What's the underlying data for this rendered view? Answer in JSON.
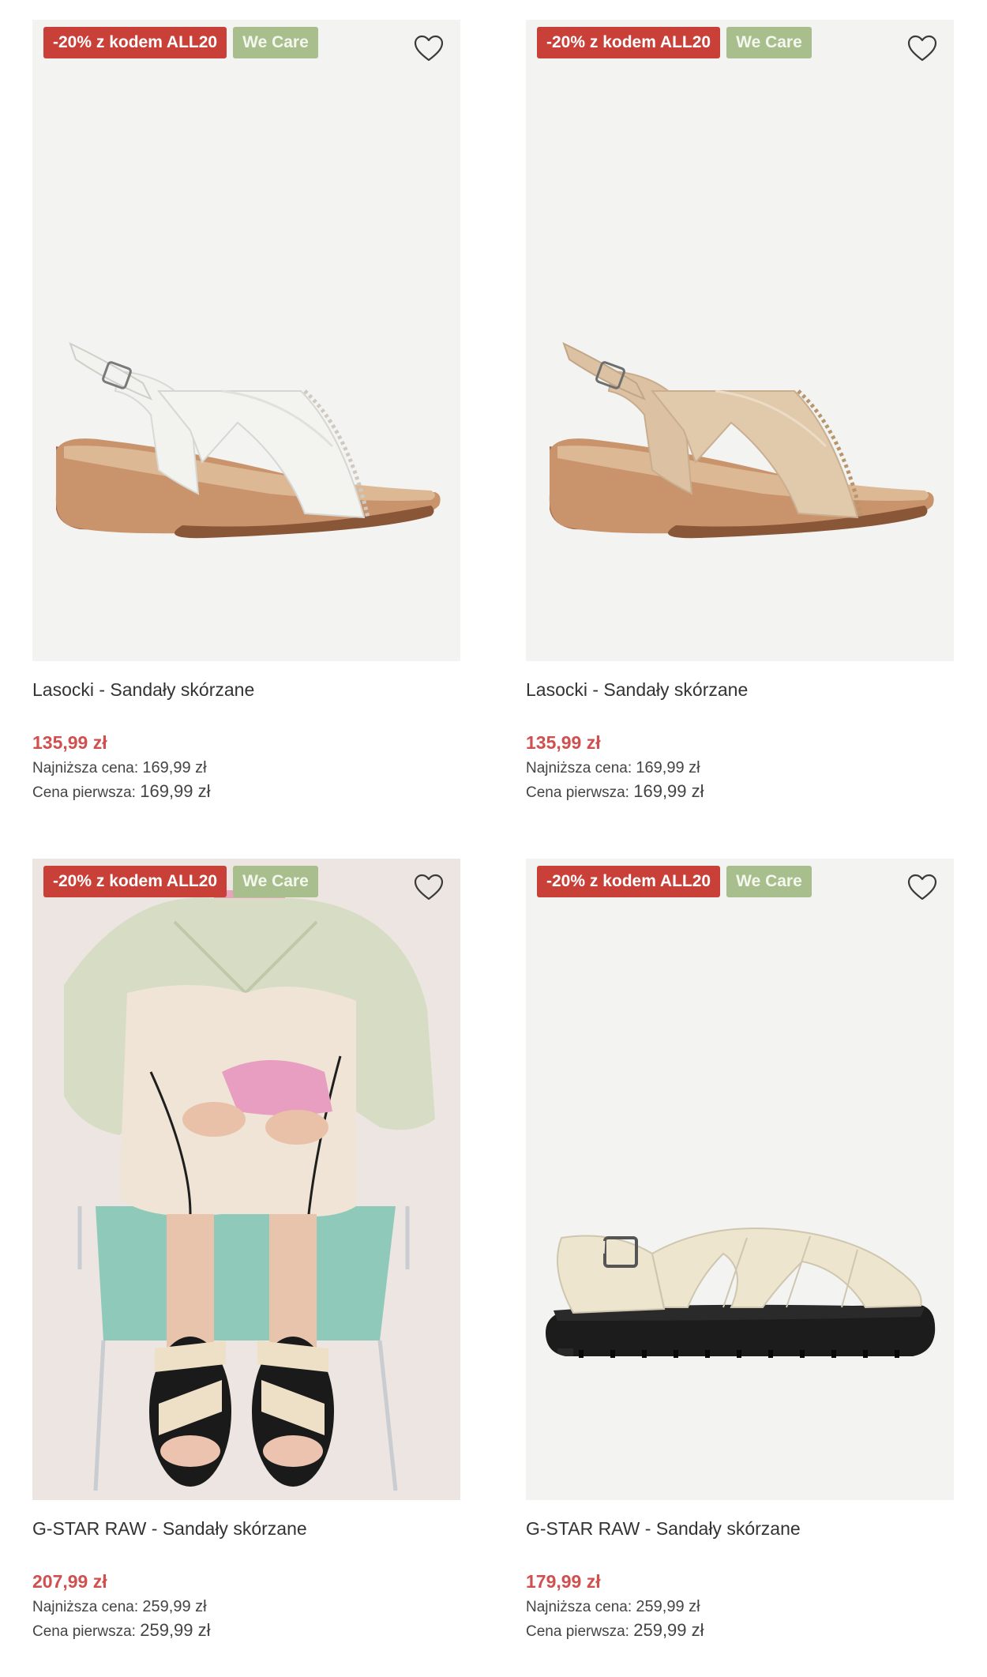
{
  "colors": {
    "promo_badge": "#c94039",
    "care_badge": "#a8be8c",
    "price": "#d05050"
  },
  "products": [
    {
      "promo_badge": "-20% z kodem ALL20",
      "care_badge": "We Care",
      "wishlist_icon": "heart-outline-icon",
      "title": "Lasocki - Sandały skórzane",
      "price": "135,99 zł",
      "lowest_label": "Najniższa cena:",
      "lowest_value": "169,99 zł",
      "first_label": "Cena pierwsza:",
      "first_value": "169,99 zł"
    },
    {
      "promo_badge": "-20% z kodem ALL20",
      "care_badge": "We Care",
      "wishlist_icon": "heart-outline-icon",
      "title": "Lasocki - Sandały skórzane",
      "price": "135,99 zł",
      "lowest_label": "Najniższa cena:",
      "lowest_value": "169,99 zł",
      "first_label": "Cena pierwsza:",
      "first_value": "169,99 zł"
    },
    {
      "promo_badge": "-20% z kodem ALL20",
      "care_badge": "We Care",
      "wishlist_icon": "heart-outline-icon",
      "title": "G-STAR RAW - Sandały skórzane",
      "price": "207,99 zł",
      "lowest_label": "Najniższa cena:",
      "lowest_value": "259,99 zł",
      "first_label": "Cena pierwsza:",
      "first_value": "259,99 zł"
    },
    {
      "promo_badge": "-20% z kodem ALL20",
      "care_badge": "We Care",
      "wishlist_icon": "heart-outline-icon",
      "title": "G-STAR RAW - Sandały skórzane",
      "price": "179,99 zł",
      "lowest_label": "Najniższa cena:",
      "lowest_value": "259,99 zł",
      "first_label": "Cena pierwsza:",
      "first_value": "259,99 zł"
    }
  ]
}
